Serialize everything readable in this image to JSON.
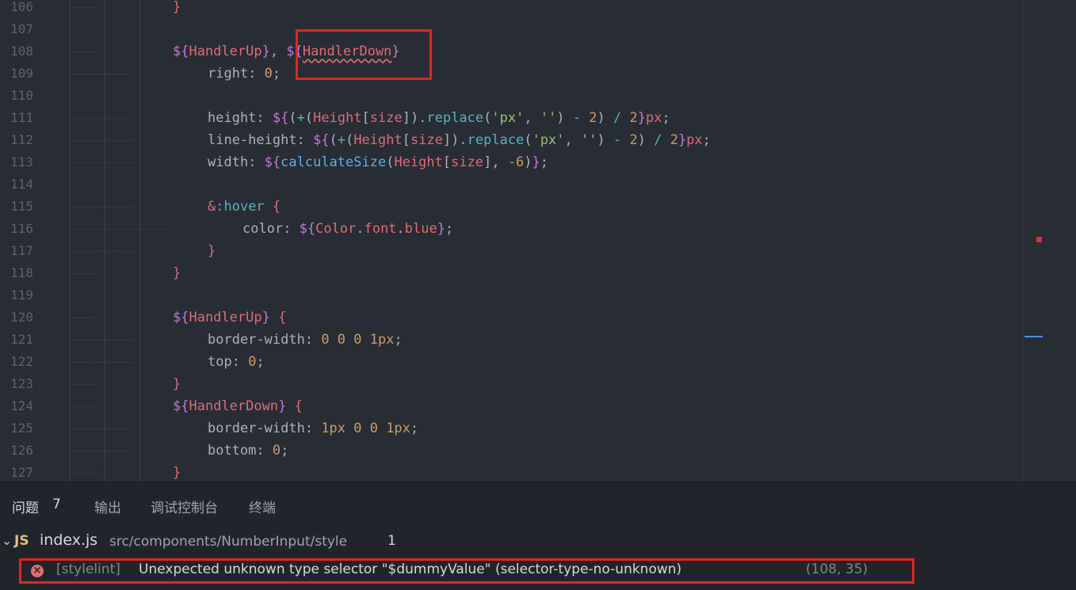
{
  "editor": {
    "lines": [
      {
        "n": "106",
        "indent": 2,
        "tokens": [
          {
            "t": "}",
            "c": "r"
          }
        ]
      },
      {
        "n": "107",
        "indent": 0,
        "tokens": []
      },
      {
        "n": "108",
        "indent": 2,
        "tokens": [
          {
            "t": "${",
            "c": "p"
          },
          {
            "t": "HandlerUp",
            "c": "r"
          },
          {
            "t": "}",
            "c": "p"
          },
          {
            "t": ", ",
            "c": "w"
          },
          {
            "t": "${",
            "c": "p"
          },
          {
            "t": "HandlerDown",
            "c": "r",
            "squig": true
          },
          {
            "t": "}",
            "c": "p"
          }
        ]
      },
      {
        "n": "109",
        "indent": 3,
        "tokens": [
          {
            "t": "right",
            "c": "w"
          },
          {
            "t": ": ",
            "c": "w"
          },
          {
            "t": "0",
            "c": "o"
          },
          {
            "t": ";",
            "c": "w"
          }
        ]
      },
      {
        "n": "110",
        "indent": 0,
        "tokens": []
      },
      {
        "n": "111",
        "indent": 3,
        "tokens": [
          {
            "t": "height",
            "c": "w"
          },
          {
            "t": ": ",
            "c": "w"
          },
          {
            "t": "${",
            "c": "p"
          },
          {
            "t": "(",
            "c": "w"
          },
          {
            "t": "+",
            "c": "c"
          },
          {
            "t": "(",
            "c": "w"
          },
          {
            "t": "Height",
            "c": "r"
          },
          {
            "t": "[",
            "c": "w"
          },
          {
            "t": "size",
            "c": "r"
          },
          {
            "t": "]",
            "c": "w"
          },
          {
            "t": ").",
            "c": "w"
          },
          {
            "t": "replace",
            "c": "c"
          },
          {
            "t": "(",
            "c": "w"
          },
          {
            "t": "'px'",
            "c": "g"
          },
          {
            "t": ", ",
            "c": "w"
          },
          {
            "t": "''",
            "c": "g"
          },
          {
            "t": ") ",
            "c": "w"
          },
          {
            "t": "-",
            "c": "c"
          },
          {
            "t": " 2",
            "c": "o"
          },
          {
            "t": ") ",
            "c": "w"
          },
          {
            "t": "/",
            "c": "c"
          },
          {
            "t": " 2",
            "c": "o"
          },
          {
            "t": "}",
            "c": "p"
          },
          {
            "t": "px",
            "c": "r"
          },
          {
            "t": ";",
            "c": "w"
          }
        ]
      },
      {
        "n": "112",
        "indent": 3,
        "tokens": [
          {
            "t": "line-height",
            "c": "w"
          },
          {
            "t": ": ",
            "c": "w"
          },
          {
            "t": "${",
            "c": "p"
          },
          {
            "t": "(",
            "c": "w"
          },
          {
            "t": "+",
            "c": "c"
          },
          {
            "t": "(",
            "c": "w"
          },
          {
            "t": "Height",
            "c": "r"
          },
          {
            "t": "[",
            "c": "w"
          },
          {
            "t": "size",
            "c": "r"
          },
          {
            "t": "]",
            "c": "w"
          },
          {
            "t": ").",
            "c": "w"
          },
          {
            "t": "replace",
            "c": "c"
          },
          {
            "t": "(",
            "c": "w"
          },
          {
            "t": "'px'",
            "c": "g"
          },
          {
            "t": ", ",
            "c": "w"
          },
          {
            "t": "''",
            "c": "g"
          },
          {
            "t": ") ",
            "c": "w"
          },
          {
            "t": "-",
            "c": "c"
          },
          {
            "t": " 2",
            "c": "o"
          },
          {
            "t": ") ",
            "c": "w"
          },
          {
            "t": "/",
            "c": "c"
          },
          {
            "t": " 2",
            "c": "o"
          },
          {
            "t": "}",
            "c": "p"
          },
          {
            "t": "px",
            "c": "r"
          },
          {
            "t": ";",
            "c": "w"
          }
        ]
      },
      {
        "n": "113",
        "indent": 3,
        "tokens": [
          {
            "t": "width",
            "c": "w"
          },
          {
            "t": ": ",
            "c": "w"
          },
          {
            "t": "${",
            "c": "p"
          },
          {
            "t": "calculateSize",
            "c": "b"
          },
          {
            "t": "(",
            "c": "w"
          },
          {
            "t": "Height",
            "c": "r"
          },
          {
            "t": "[",
            "c": "w"
          },
          {
            "t": "size",
            "c": "r"
          },
          {
            "t": "], ",
            "c": "w"
          },
          {
            "t": "-6",
            "c": "o"
          },
          {
            "t": ")",
            "c": "w"
          },
          {
            "t": "}",
            "c": "p"
          },
          {
            "t": ";",
            "c": "w"
          }
        ]
      },
      {
        "n": "114",
        "indent": 0,
        "tokens": []
      },
      {
        "n": "115",
        "indent": 3,
        "tokens": [
          {
            "t": "&",
            "c": "r"
          },
          {
            "t": ":hover",
            "c": "c"
          },
          {
            "t": " {",
            "c": "r"
          }
        ]
      },
      {
        "n": "116",
        "indent": 4,
        "tokens": [
          {
            "t": "color",
            "c": "w"
          },
          {
            "t": ": ",
            "c": "w"
          },
          {
            "t": "${",
            "c": "p"
          },
          {
            "t": "Color",
            "c": "r"
          },
          {
            "t": ".",
            "c": "w"
          },
          {
            "t": "font",
            "c": "r"
          },
          {
            "t": ".",
            "c": "w"
          },
          {
            "t": "blue",
            "c": "r"
          },
          {
            "t": "}",
            "c": "p"
          },
          {
            "t": ";",
            "c": "w"
          }
        ]
      },
      {
        "n": "117",
        "indent": 3,
        "tokens": [
          {
            "t": "}",
            "c": "r"
          }
        ]
      },
      {
        "n": "118",
        "indent": 2,
        "tokens": [
          {
            "t": "}",
            "c": "r"
          }
        ]
      },
      {
        "n": "119",
        "indent": 0,
        "tokens": []
      },
      {
        "n": "120",
        "indent": 2,
        "tokens": [
          {
            "t": "${",
            "c": "p"
          },
          {
            "t": "HandlerUp",
            "c": "r"
          },
          {
            "t": "}",
            "c": "p"
          },
          {
            "t": " {",
            "c": "r"
          }
        ]
      },
      {
        "n": "121",
        "indent": 3,
        "tokens": [
          {
            "t": "border-width",
            "c": "w"
          },
          {
            "t": ": ",
            "c": "w"
          },
          {
            "t": "0 0 0 1px",
            "c": "o"
          },
          {
            "t": ";",
            "c": "w"
          }
        ]
      },
      {
        "n": "122",
        "indent": 3,
        "tokens": [
          {
            "t": "top",
            "c": "w"
          },
          {
            "t": ": ",
            "c": "w"
          },
          {
            "t": "0",
            "c": "o"
          },
          {
            "t": ";",
            "c": "w"
          }
        ]
      },
      {
        "n": "123",
        "indent": 2,
        "tokens": [
          {
            "t": "}",
            "c": "r"
          }
        ]
      },
      {
        "n": "124",
        "indent": 2,
        "tokens": [
          {
            "t": "${",
            "c": "p"
          },
          {
            "t": "HandlerDown",
            "c": "r"
          },
          {
            "t": "}",
            "c": "p"
          },
          {
            "t": " {",
            "c": "r"
          }
        ]
      },
      {
        "n": "125",
        "indent": 3,
        "tokens": [
          {
            "t": "border-width",
            "c": "w"
          },
          {
            "t": ": ",
            "c": "w"
          },
          {
            "t": "1px 0 0 1px",
            "c": "o"
          },
          {
            "t": ";",
            "c": "w"
          }
        ]
      },
      {
        "n": "126",
        "indent": 3,
        "tokens": [
          {
            "t": "bottom",
            "c": "w"
          },
          {
            "t": ": ",
            "c": "w"
          },
          {
            "t": "0",
            "c": "o"
          },
          {
            "t": ";",
            "c": "w"
          }
        ]
      },
      {
        "n": "127",
        "indent": 2,
        "tokens": [
          {
            "t": "}",
            "c": "r"
          }
        ]
      }
    ]
  },
  "panel": {
    "tabs": [
      {
        "label": "问题",
        "active": true
      },
      {
        "label": "输出",
        "active": false
      },
      {
        "label": "调试控制台",
        "active": false
      },
      {
        "label": "终端",
        "active": false
      }
    ],
    "problem_count": "7",
    "file": {
      "icon_text": "JS",
      "name": "index.js",
      "path": "src/components/NumberInput/style",
      "count": "1"
    },
    "error": {
      "source": "[stylelint]",
      "message": "Unexpected unknown type selector \"$dummyValue\" (selector-type-no-unknown)",
      "position": "(108, 35)"
    }
  },
  "colors": {
    "error": "#e06c75",
    "highlight_box": "#e8231f",
    "background": "#282c34"
  }
}
